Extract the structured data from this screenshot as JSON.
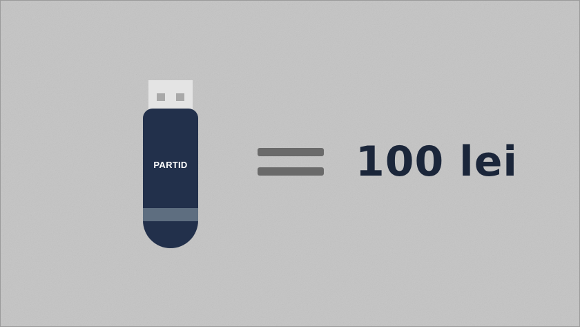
{
  "usb_drive": {
    "label": "PARTID",
    "body_color": "#22304b",
    "band_color": "#5e6e80",
    "connector_color": "#e4e4e4"
  },
  "equals_sign": {
    "icon": "equals-icon",
    "color": "#6a6a6a"
  },
  "price": {
    "text": "100 lei",
    "color": "#1b263a"
  },
  "background_color": "#c4c4c4"
}
